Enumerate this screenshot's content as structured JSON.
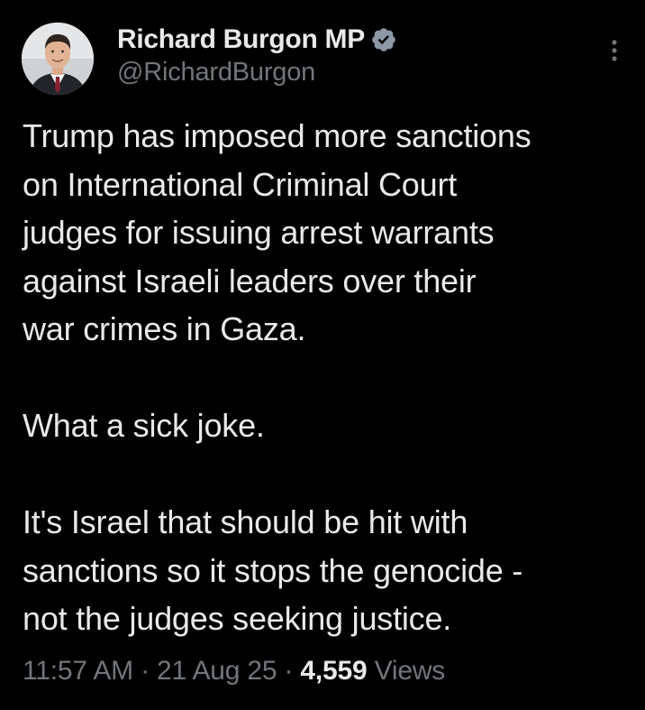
{
  "author": {
    "name": "Richard Burgon MP",
    "handle": "@RichardBurgon",
    "verified": true,
    "verified_color": "#8b98a5"
  },
  "tweet": {
    "paragraphs": [
      [
        "Trump has imposed more sanctions",
        "on International Criminal Court",
        "judges for issuing arrest warrants",
        "against Israeli leaders over their",
        "war crimes in Gaza."
      ],
      [
        "What a sick joke."
      ],
      [
        "It's Israel that should be hit with",
        "sanctions so it stops the genocide -",
        "not the judges seeking justice."
      ]
    ]
  },
  "meta": {
    "time": "11:57 AM",
    "separator": " · ",
    "date": "21 Aug 25",
    "views_count": "4,559",
    "views_label": "Views"
  },
  "icons": {
    "more": "more-vertical-icon",
    "verified": "verified-badge-icon"
  },
  "colors": {
    "background": "#000000",
    "primary_text": "#e7e9ea",
    "secondary_text": "#71767b"
  }
}
